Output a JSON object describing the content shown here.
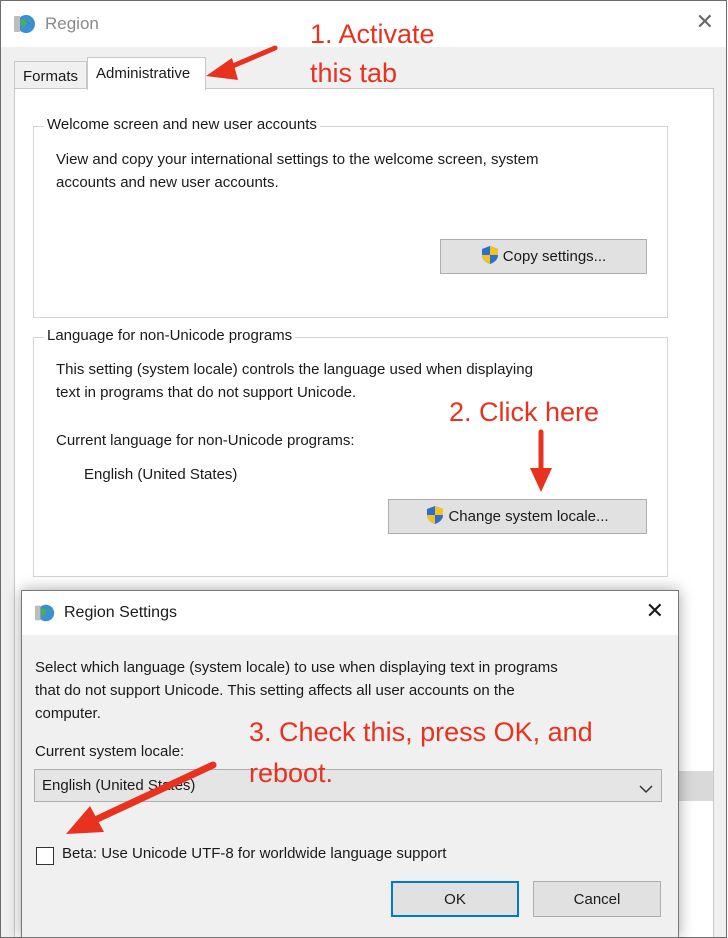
{
  "window": {
    "title": "Region",
    "close_glyph": "✕"
  },
  "tabs": [
    {
      "label": "Formats",
      "active": false
    },
    {
      "label": "Administrative",
      "active": true
    }
  ],
  "welcome_group": {
    "title": "Welcome screen and new user accounts",
    "line1": "View and copy your international settings to the welcome screen, system",
    "line2": "accounts and new user accounts.",
    "button": "Copy settings..."
  },
  "unicode_group": {
    "title": "Language for non-Unicode programs",
    "line1": "This setting (system locale) controls the language used when displaying",
    "line2": "text in programs that do not support Unicode.",
    "current_label": "Current language for non-Unicode programs:",
    "current_value": "English (United States)",
    "button": "Change system locale..."
  },
  "dialog": {
    "title": "Region Settings",
    "close_glyph": "✕",
    "line1": "Select which language (system locale) to use when displaying text in programs",
    "line2": "that do not support Unicode. This setting affects all user accounts on the",
    "line3": "computer.",
    "locale_label": "Current system locale:",
    "locale_value": "English (United States)",
    "checkbox_label": "Beta: Use Unicode UTF-8 for worldwide language support",
    "checkbox_checked": false,
    "ok": "OK",
    "cancel": "Cancel"
  },
  "annotations": {
    "step1_line1": "1. Activate",
    "step1_line2": "this tab",
    "step2": "2. Click here",
    "step3_line1": "3. Check this, press OK, and",
    "step3_line2": "reboot.",
    "color": "#e8321f"
  },
  "icons": {
    "app": "globe-icon",
    "shield": "uac-shield-icon",
    "dropdown": "chevron-down-icon"
  }
}
